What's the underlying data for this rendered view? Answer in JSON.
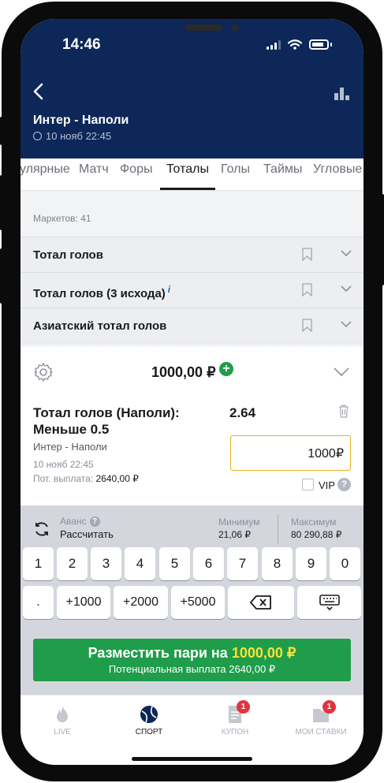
{
  "status_bar": {
    "time": "14:46"
  },
  "header": {
    "match_title": "Интер - Наполи",
    "match_date": "10 нояб 22:45",
    "stats_icon": "bar-chart-icon",
    "back_icon": "chevron-left-icon"
  },
  "tabs": [
    {
      "label": "улярные"
    },
    {
      "label": "Матч"
    },
    {
      "label": "Форы"
    },
    {
      "label": "Тоталы",
      "active": true
    },
    {
      "label": "Голы"
    },
    {
      "label": "Таймы"
    },
    {
      "label": "Угловые"
    }
  ],
  "markets": {
    "count_label": "Маркетов: 41",
    "items": [
      {
        "label": "Тотал голов"
      },
      {
        "label": "Тотал голов (3 исхода)",
        "info": "i"
      },
      {
        "label": "Азиатский тотал голов"
      }
    ]
  },
  "slip": {
    "total_stake": "1000,00 ₽",
    "bet_title": "Тотал голов (Наполи): Меньше 0.5",
    "odds": "2.64",
    "match": "Интер - Наполи",
    "date": "10 нояб 22:45",
    "payout_label": "Пот. выплата:",
    "payout_value": "2640,00 ₽",
    "stake_value": "1000₽",
    "vip_label": "VIP",
    "vip_help": "?"
  },
  "keyboard": {
    "advance_label": "Аванс",
    "advance_help": "?",
    "calculate_label": "Рассчитать",
    "min_label": "Минимум",
    "min_value": "21,06 ₽",
    "max_label": "Максимум",
    "max_value": "80 290,88 ₽",
    "digits": [
      "1",
      "2",
      "3",
      "4",
      "5",
      "6",
      "7",
      "8",
      "9",
      "0"
    ],
    "dot": ".",
    "quick": [
      "+1000",
      "+2000",
      "+5000"
    ]
  },
  "place_bet": {
    "label_prefix": "Разместить пари на",
    "amount": "1000,00 ₽",
    "sub": "Потенциальная выплата 2640,00 ₽"
  },
  "bottom_nav": [
    {
      "label": "LIVE",
      "icon": "flame-icon"
    },
    {
      "label": "СПОРТ",
      "icon": "ball-icon",
      "active": true
    },
    {
      "label": "КУПОН",
      "icon": "coupon-icon",
      "badge": "1"
    },
    {
      "label": "МОИ СТАВКИ",
      "icon": "my-bets-icon",
      "badge": "1"
    }
  ],
  "colors": {
    "header_bg": "#0c2758",
    "accent_green": "#1f9d4a",
    "input_border": "#e3b31f",
    "badge_red": "#e0343e",
    "amount_yellow": "#ffe234"
  }
}
